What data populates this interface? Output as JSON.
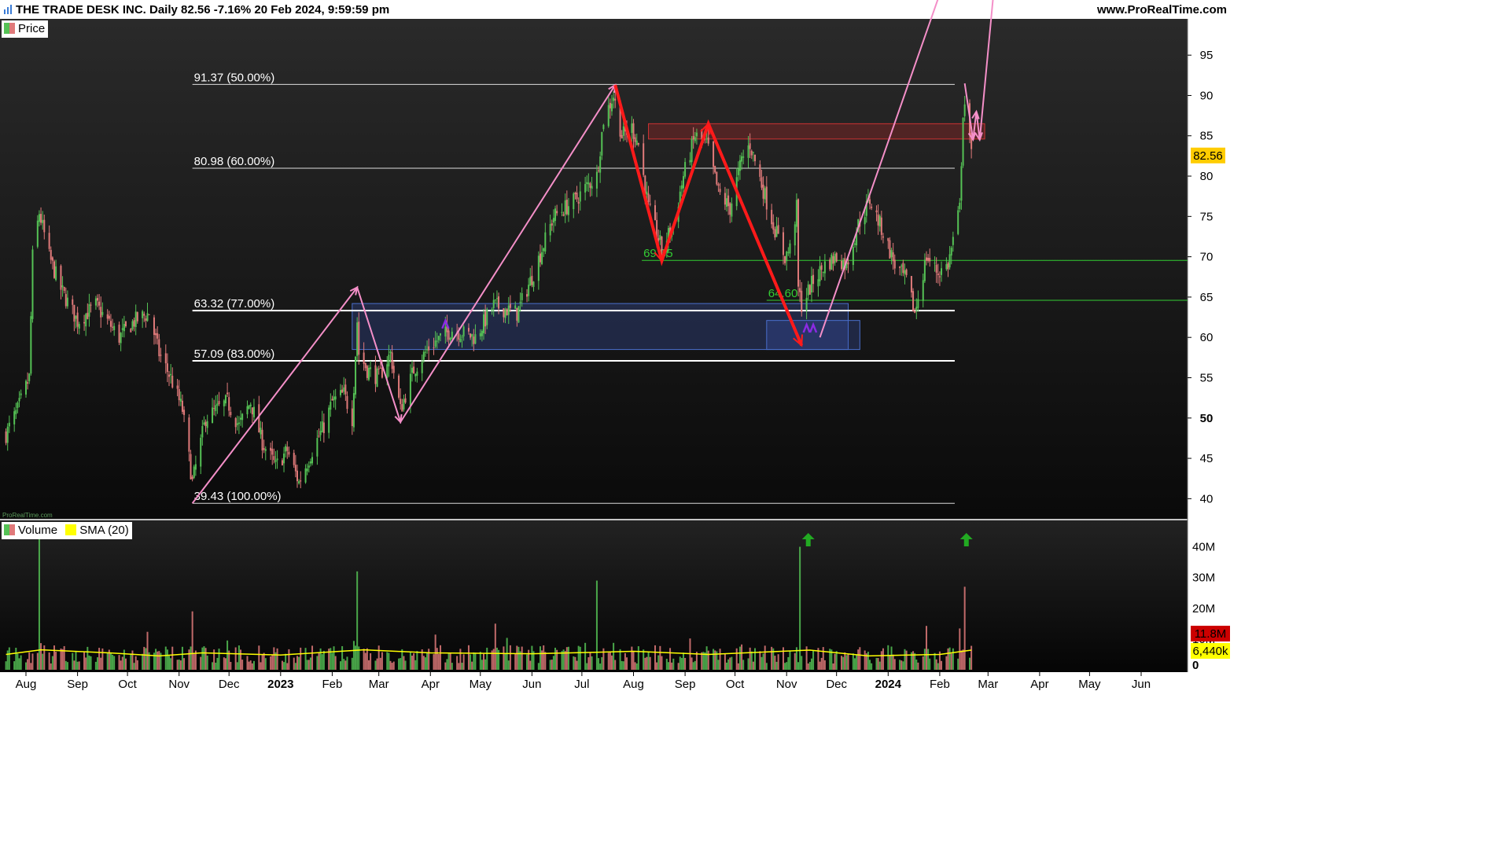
{
  "header": {
    "title": "THE TRADE DESK INC. Daily 82.56 -7.16% 20 Feb 2024, 9:59:59 pm",
    "site": "www.ProRealTime.com",
    "watermark": "ProRealTime.com"
  },
  "legends": {
    "price": "Price",
    "volume": "Volume",
    "sma": "SMA (20)"
  },
  "colors": {
    "up": "#55c255",
    "down": "#e07a7a",
    "sma": "#ffff00",
    "zigzag_pink": "#f48fc8",
    "zigzag_red": "#ff1a1a",
    "support_green": "#33cc33",
    "box_blue": "#4a6fcc",
    "box_red": "#cc3333",
    "price_tag": "#ffcc00",
    "volume_tag_red": "#cc0000",
    "volume_tag_yellow": "#ffff00"
  },
  "chart_data": [
    {
      "type": "candlestick",
      "ylim": [
        37.5,
        99.5
      ],
      "y_ticks": [
        40,
        45,
        50,
        55,
        60,
        65,
        70,
        75,
        80,
        85,
        90,
        95
      ],
      "last_price": 82.56,
      "last_price_label": "82.56",
      "x_ticks": [
        {
          "label": "Aug",
          "date": "2022-08-01"
        },
        {
          "label": "Sep",
          "date": "2022-09-01"
        },
        {
          "label": "Oct",
          "date": "2022-10-01"
        },
        {
          "label": "Nov",
          "date": "2022-11-01"
        },
        {
          "label": "Dec",
          "date": "2022-12-01"
        },
        {
          "label": "2023",
          "date": "2023-01-01"
        },
        {
          "label": "Feb",
          "date": "2023-02-01"
        },
        {
          "label": "Mar",
          "date": "2023-03-01"
        },
        {
          "label": "Apr",
          "date": "2023-04-01"
        },
        {
          "label": "May",
          "date": "2023-05-01"
        },
        {
          "label": "Jun",
          "date": "2023-06-01"
        },
        {
          "label": "Jul",
          "date": "2023-07-01"
        },
        {
          "label": "Aug",
          "date": "2023-08-01"
        },
        {
          "label": "Sep",
          "date": "2023-09-01"
        },
        {
          "label": "Oct",
          "date": "2023-10-01"
        },
        {
          "label": "Nov",
          "date": "2023-11-01"
        },
        {
          "label": "Dec",
          "date": "2023-12-01"
        },
        {
          "label": "2024",
          "date": "2024-01-01"
        },
        {
          "label": "Feb",
          "date": "2024-02-01"
        },
        {
          "label": "Mar",
          "date": "2024-03-01"
        },
        {
          "label": "Apr",
          "date": "2024-04-01"
        },
        {
          "label": "May",
          "date": "2024-05-01"
        },
        {
          "label": "Jun",
          "date": "2024-06-01"
        }
      ],
      "close_path": [
        [
          "2022-07-20",
          48
        ],
        [
          "2022-07-27",
          51
        ],
        [
          "2022-08-03",
          55
        ],
        [
          "2022-08-05",
          70
        ],
        [
          "2022-08-09",
          75.5
        ],
        [
          "2022-08-15",
          70
        ],
        [
          "2022-08-22",
          66
        ],
        [
          "2022-09-01",
          62
        ],
        [
          "2022-09-12",
          64
        ],
        [
          "2022-09-26",
          60
        ],
        [
          "2022-10-05",
          62
        ],
        [
          "2022-10-14",
          63
        ],
        [
          "2022-10-20",
          58
        ],
        [
          "2022-10-27",
          55
        ],
        [
          "2022-11-03",
          51
        ],
        [
          "2022-11-09",
          42
        ],
        [
          "2022-11-17",
          50
        ],
        [
          "2022-11-30",
          52
        ],
        [
          "2022-12-07",
          49
        ],
        [
          "2022-12-14",
          52
        ],
        [
          "2022-12-21",
          47
        ],
        [
          "2022-12-29",
          44
        ],
        [
          "2023-01-05",
          46
        ],
        [
          "2023-01-12",
          42
        ],
        [
          "2023-01-20",
          46
        ],
        [
          "2023-01-27",
          49
        ],
        [
          "2023-02-01",
          52
        ],
        [
          "2023-02-08",
          53
        ],
        [
          "2023-02-13",
          50
        ],
        [
          "2023-02-16",
          62
        ],
        [
          "2023-02-17",
          58
        ],
        [
          "2023-02-22",
          56
        ],
        [
          "2023-03-01",
          55
        ],
        [
          "2023-03-08",
          58
        ],
        [
          "2023-03-14",
          51
        ],
        [
          "2023-03-22",
          56
        ],
        [
          "2023-04-01",
          59
        ],
        [
          "2023-04-14",
          61
        ],
        [
          "2023-04-28",
          60
        ],
        [
          "2023-05-09",
          64
        ],
        [
          "2023-05-23",
          63
        ],
        [
          "2023-06-02",
          68
        ],
        [
          "2023-06-14",
          75
        ],
        [
          "2023-06-27",
          77
        ],
        [
          "2023-07-05",
          79
        ],
        [
          "2023-07-10",
          80
        ],
        [
          "2023-07-14",
          87
        ],
        [
          "2023-07-20",
          90
        ],
        [
          "2023-07-25",
          85
        ],
        [
          "2023-07-31",
          86
        ],
        [
          "2023-08-04",
          84
        ],
        [
          "2023-08-10",
          76
        ],
        [
          "2023-08-18",
          71
        ],
        [
          "2023-08-25",
          74
        ],
        [
          "2023-08-31",
          80
        ],
        [
          "2023-09-07",
          85
        ],
        [
          "2023-09-14",
          84
        ],
        [
          "2023-09-21",
          78
        ],
        [
          "2023-09-28",
          76
        ],
        [
          "2023-10-05",
          82
        ],
        [
          "2023-10-10",
          84
        ],
        [
          "2023-10-17",
          79
        ],
        [
          "2023-10-24",
          74
        ],
        [
          "2023-10-31",
          70
        ],
        [
          "2023-11-03",
          71
        ],
        [
          "2023-11-07",
          76
        ],
        [
          "2023-11-08",
          66
        ],
        [
          "2023-11-10",
          64
        ],
        [
          "2023-11-17",
          67
        ],
        [
          "2023-11-24",
          69
        ],
        [
          "2023-12-01",
          70
        ],
        [
          "2023-12-07",
          69
        ],
        [
          "2023-12-14",
          74
        ],
        [
          "2023-12-21",
          77
        ],
        [
          "2023-12-29",
          73
        ],
        [
          "2024-01-05",
          69
        ],
        [
          "2024-01-12",
          67
        ],
        [
          "2024-01-17",
          63
        ],
        [
          "2024-01-24",
          70
        ],
        [
          "2024-01-31",
          68
        ],
        [
          "2024-02-06",
          69
        ],
        [
          "2024-02-13",
          76
        ],
        [
          "2024-02-15",
          88
        ],
        [
          "2024-02-16",
          89
        ],
        [
          "2024-02-20",
          82.56
        ]
      ],
      "fib_levels": [
        {
          "label": "91.37 (50.00%)",
          "value": 91.37,
          "thick": false
        },
        {
          "label": "80.98 (60.00%)",
          "value": 80.98,
          "thick": false
        },
        {
          "label": "63.32 (77.00%)",
          "value": 63.32,
          "thick": true
        },
        {
          "label": "57.09 (83.00%)",
          "value": 57.09,
          "thick": true
        },
        {
          "label": "39.43 (100.00%)",
          "value": 39.43,
          "thick": false
        }
      ],
      "fib_range": [
        "2022-11-09",
        "2024-02-10"
      ],
      "support_lines": [
        {
          "label": "69.55",
          "value": 69.55,
          "from": "2023-08-06"
        },
        {
          "label": "64.60",
          "value": 64.6,
          "from": "2023-10-20"
        }
      ],
      "zones": [
        {
          "kind": "blue",
          "from": "2023-02-13",
          "to": "2023-12-08",
          "low": 58.5,
          "high": 64.2
        },
        {
          "kind": "blue",
          "from": "2023-10-20",
          "to": "2023-12-15",
          "low": 58.5,
          "high": 62.1
        },
        {
          "kind": "red",
          "from": "2023-08-10",
          "to": "2024-02-28",
          "low": 84.6,
          "high": 86.5
        }
      ],
      "pink_zigzag": [
        [
          [
            "2022-11-09",
            39.43
          ],
          [
            "2023-02-16",
            66.2
          ],
          [
            "2023-03-14",
            49.5
          ],
          [
            "2023-07-21",
            91.3
          ]
        ],
        [
          [
            "2023-11-21",
            60
          ],
          [
            "2024-01-31",
            102
          ]
        ],
        [
          [
            "2024-02-16",
            91.5
          ],
          [
            "2024-02-21",
            84.5
          ],
          [
            "2024-02-23",
            88
          ],
          [
            "2024-02-25",
            84.5
          ],
          [
            "2024-03-04",
            102
          ]
        ]
      ],
      "red_zigzag": [
        [
          "2023-07-21",
          91.3
        ],
        [
          "2023-08-18",
          69.5
        ],
        [
          "2023-09-15",
          86.5
        ],
        [
          "2023-11-10",
          59
        ]
      ],
      "purple_marks": [
        [
          "2023-04-10",
          61.5
        ],
        [
          "2023-11-13",
          61
        ],
        [
          "2023-11-17",
          61
        ]
      ]
    },
    {
      "type": "bar",
      "title": "Volume",
      "ylim": [
        0,
        45
      ],
      "y_ticks": [
        {
          "value": 0,
          "label": "0"
        },
        {
          "value": 10,
          "label": "10M"
        },
        {
          "value": 20,
          "label": "20M"
        },
        {
          "value": 30,
          "label": "30M"
        },
        {
          "value": 40,
          "label": "40M"
        }
      ],
      "sma_value_label": "6,440k",
      "last_volume_label": "11.8M",
      "spikes": [
        [
          "2022-08-09",
          45
        ],
        [
          "2022-11-09",
          19
        ],
        [
          "2023-02-16",
          32
        ],
        [
          "2023-05-10",
          15
        ],
        [
          "2023-07-10",
          29
        ],
        [
          "2023-11-09",
          40
        ],
        [
          "2024-02-16",
          27
        ]
      ],
      "sma_path": [
        [
          "2022-07-20",
          5
        ],
        [
          "2022-08-10",
          6.5
        ],
        [
          "2022-09-20",
          5.5
        ],
        [
          "2022-10-20",
          4.5
        ],
        [
          "2022-11-15",
          5.5
        ],
        [
          "2023-01-01",
          4.8
        ],
        [
          "2023-02-20",
          6.5
        ],
        [
          "2023-04-01",
          5.5
        ],
        [
          "2023-06-01",
          5.2
        ],
        [
          "2023-08-01",
          6
        ],
        [
          "2023-09-15",
          5
        ],
        [
          "2023-11-15",
          6.4
        ],
        [
          "2023-12-20",
          4.5
        ],
        [
          "2024-02-01",
          5
        ],
        [
          "2024-02-20",
          6.4
        ]
      ],
      "signal_arrows": [
        "2023-11-14",
        "2024-02-17"
      ]
    }
  ]
}
